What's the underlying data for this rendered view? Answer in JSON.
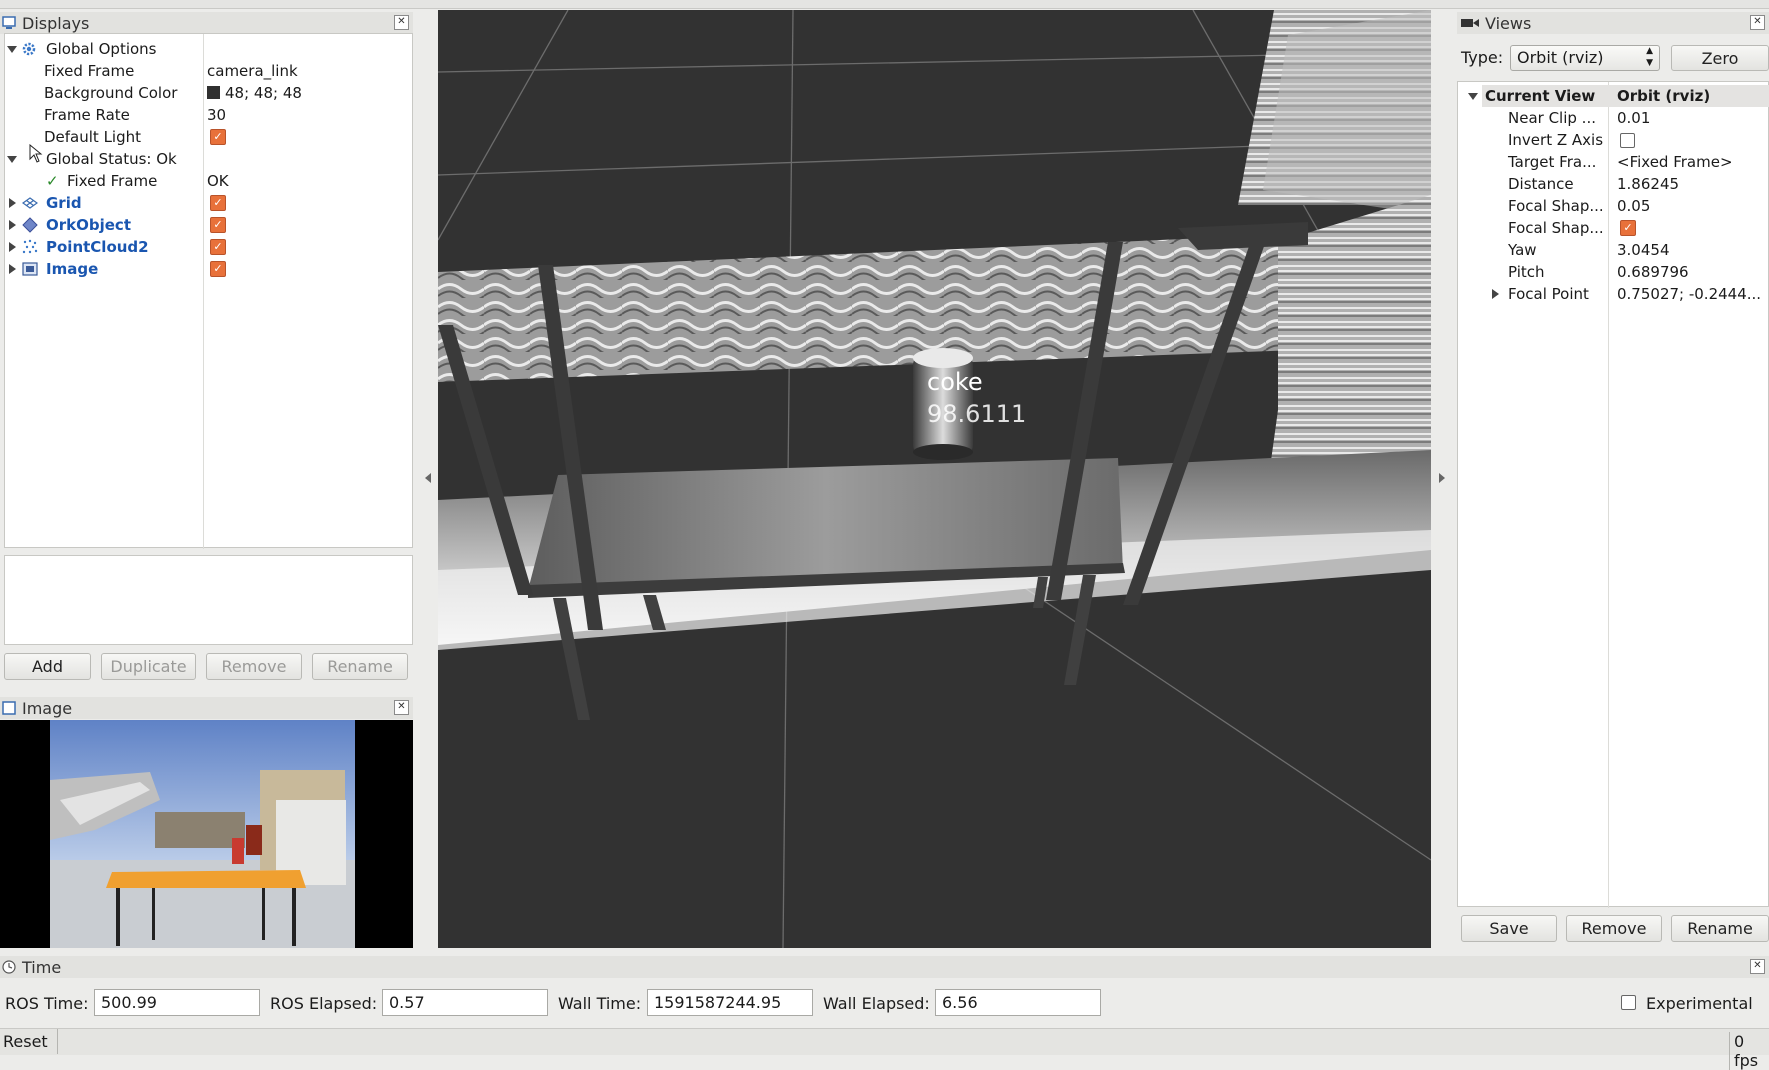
{
  "displays": {
    "title": "Displays",
    "tree": {
      "global_options": "Global Options",
      "fixed_frame_label": "Fixed Frame",
      "fixed_frame_value": "camera_link",
      "bg_color_label": "Background Color",
      "bg_color_value": "48; 48; 48",
      "frame_rate_label": "Frame Rate",
      "frame_rate_value": "30",
      "default_light_label": "Default Light",
      "global_status": "Global Status: Ok",
      "status_fixed_frame_label": "Fixed Frame",
      "status_fixed_frame_value": "OK",
      "grid": "Grid",
      "orkobject": "OrkObject",
      "pointcloud2": "PointCloud2",
      "image": "Image"
    },
    "buttons": {
      "add": "Add",
      "duplicate": "Duplicate",
      "remove": "Remove",
      "rename": "Rename"
    }
  },
  "image_panel": {
    "title": "Image"
  },
  "scene": {
    "object_label": "coke",
    "object_score": "98.6111"
  },
  "views": {
    "title": "Views",
    "type_label": "Type:",
    "type_value": "Orbit (rviz)",
    "zero_button": "Zero",
    "header_name": "Current View",
    "header_value": "Orbit (rviz)",
    "props": [
      {
        "name": "Near Clip ...",
        "value": "0.01"
      },
      {
        "name": "Invert Z Axis",
        "value": ""
      },
      {
        "name": "Target Fra...",
        "value": "<Fixed Frame>"
      },
      {
        "name": "Distance",
        "value": "1.86245"
      },
      {
        "name": "Focal Shap...",
        "value": "0.05"
      },
      {
        "name": "Focal Shap...",
        "value": ""
      },
      {
        "name": "Yaw",
        "value": "3.0454"
      },
      {
        "name": "Pitch",
        "value": "0.689796"
      },
      {
        "name": "Focal Point",
        "value": "0.75027; -0.2444..."
      }
    ],
    "buttons": {
      "save": "Save",
      "remove": "Remove",
      "rename": "Rename"
    }
  },
  "time": {
    "title": "Time",
    "ros_time_label": "ROS Time:",
    "ros_time_value": "500.99",
    "ros_elapsed_label": "ROS Elapsed:",
    "ros_elapsed_value": "0.57",
    "wall_time_label": "Wall Time:",
    "wall_time_value": "1591587244.95",
    "wall_elapsed_label": "Wall Elapsed:",
    "wall_elapsed_value": "6.56",
    "experimental_label": "Experimental"
  },
  "statusbar": {
    "reset": "Reset",
    "fps": "0 fps"
  },
  "colors": {
    "accent_checkbox": "#e8713a",
    "link_blue": "#1a56b0",
    "scene_bg": "#323232"
  },
  "icons": [
    "monitor-icon",
    "gear-icon",
    "grid-icon",
    "diamond-icon",
    "pointcloud-icon",
    "image-icon",
    "camera-icon",
    "clock-icon",
    "close-icon"
  ]
}
